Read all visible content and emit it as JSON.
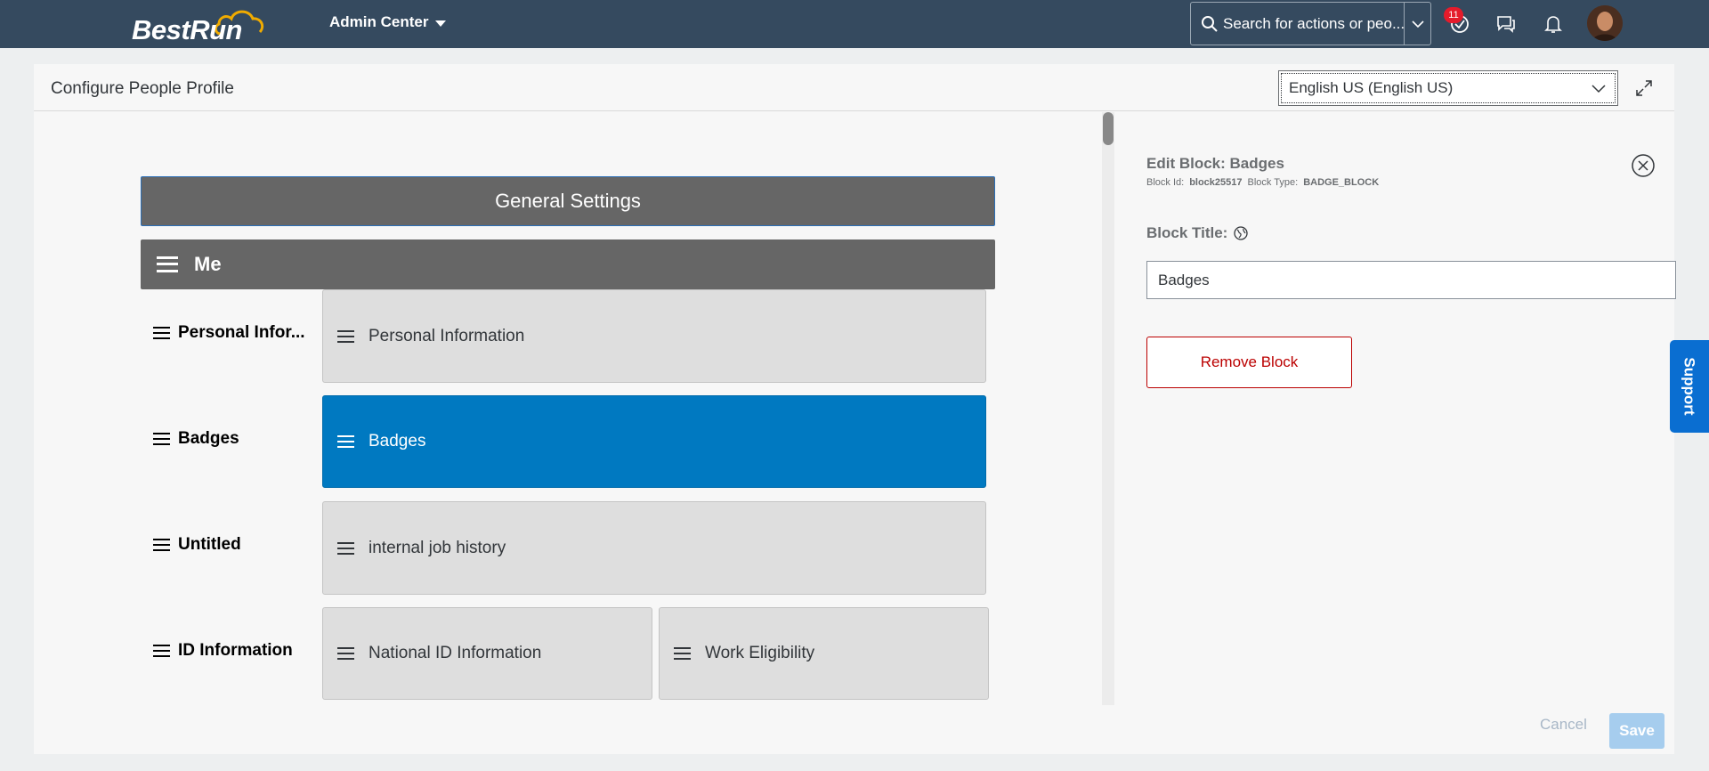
{
  "shell": {
    "logo_text": "BestRun",
    "module_label": "Admin Center",
    "search_placeholder": "Search for actions or peo...",
    "notification_count": "11"
  },
  "page": {
    "title": "Configure People Profile",
    "language_selected": "English US (English US)"
  },
  "layout": {
    "general_settings_label": "General Settings",
    "section_label": "Me",
    "rows": [
      {
        "label": "Personal Infor...",
        "blocks": [
          "Personal Information"
        ]
      },
      {
        "label": "Badges",
        "blocks": [
          "Badges"
        ]
      },
      {
        "label": "Untitled",
        "blocks": [
          "internal job history"
        ]
      },
      {
        "label": "ID Information",
        "blocks": [
          "National ID Information",
          "Work Eligibility"
        ]
      }
    ]
  },
  "edit_block": {
    "heading": "Edit Block:",
    "block_name": "Badges",
    "block_id_label": "Block Id:",
    "block_id": "block25517",
    "block_type_label": "Block Type:",
    "block_type": "BADGE_BLOCK",
    "title_label": "Block Title:",
    "title_value": "Badges",
    "remove_label": "Remove Block"
  },
  "footer": {
    "cancel_label": "Cancel",
    "save_label": "Save"
  },
  "support_label": "Support",
  "colors": {
    "shell": "#354a5f",
    "selected_block": "#0079c1",
    "danger": "#bb0000",
    "support": "#0a6ed1"
  }
}
